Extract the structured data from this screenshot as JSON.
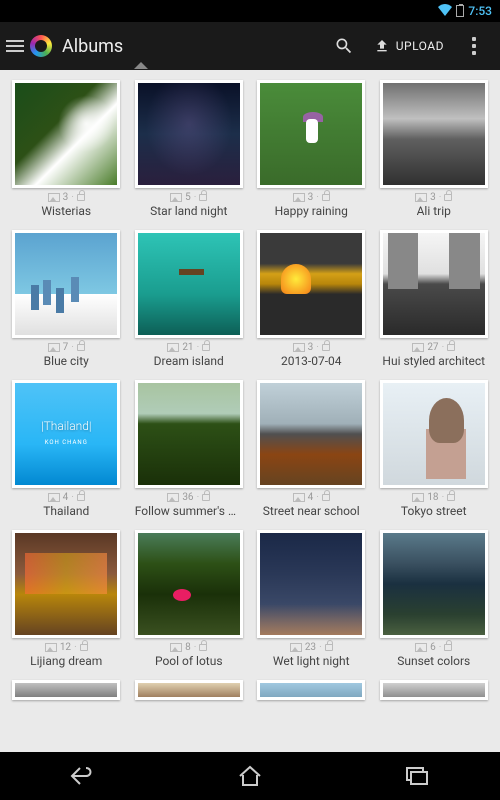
{
  "status": {
    "time": "7:53"
  },
  "header": {
    "title": "Albums",
    "upload_label": "UPLOAD"
  },
  "albums": [
    {
      "title": "Wisterias",
      "count": "3"
    },
    {
      "title": "Star land night",
      "count": "5"
    },
    {
      "title": "Happy raining",
      "count": "3"
    },
    {
      "title": "Ali trip",
      "count": "3"
    },
    {
      "title": "Blue city",
      "count": "7"
    },
    {
      "title": "Dream island",
      "count": "21"
    },
    {
      "title": "2013-07-04",
      "count": "3"
    },
    {
      "title": "Hui styled architect",
      "count": "27"
    },
    {
      "title": "Thailand",
      "count": "4"
    },
    {
      "title": "Follow summer's m…",
      "count": "36"
    },
    {
      "title": "Street near school",
      "count": "4"
    },
    {
      "title": "Tokyo street",
      "count": "18"
    },
    {
      "title": "Lijiang dream",
      "count": "12"
    },
    {
      "title": "Pool of lotus",
      "count": "8"
    },
    {
      "title": "Wet light night",
      "count": "23"
    },
    {
      "title": "Sunset colors",
      "count": "6"
    }
  ]
}
